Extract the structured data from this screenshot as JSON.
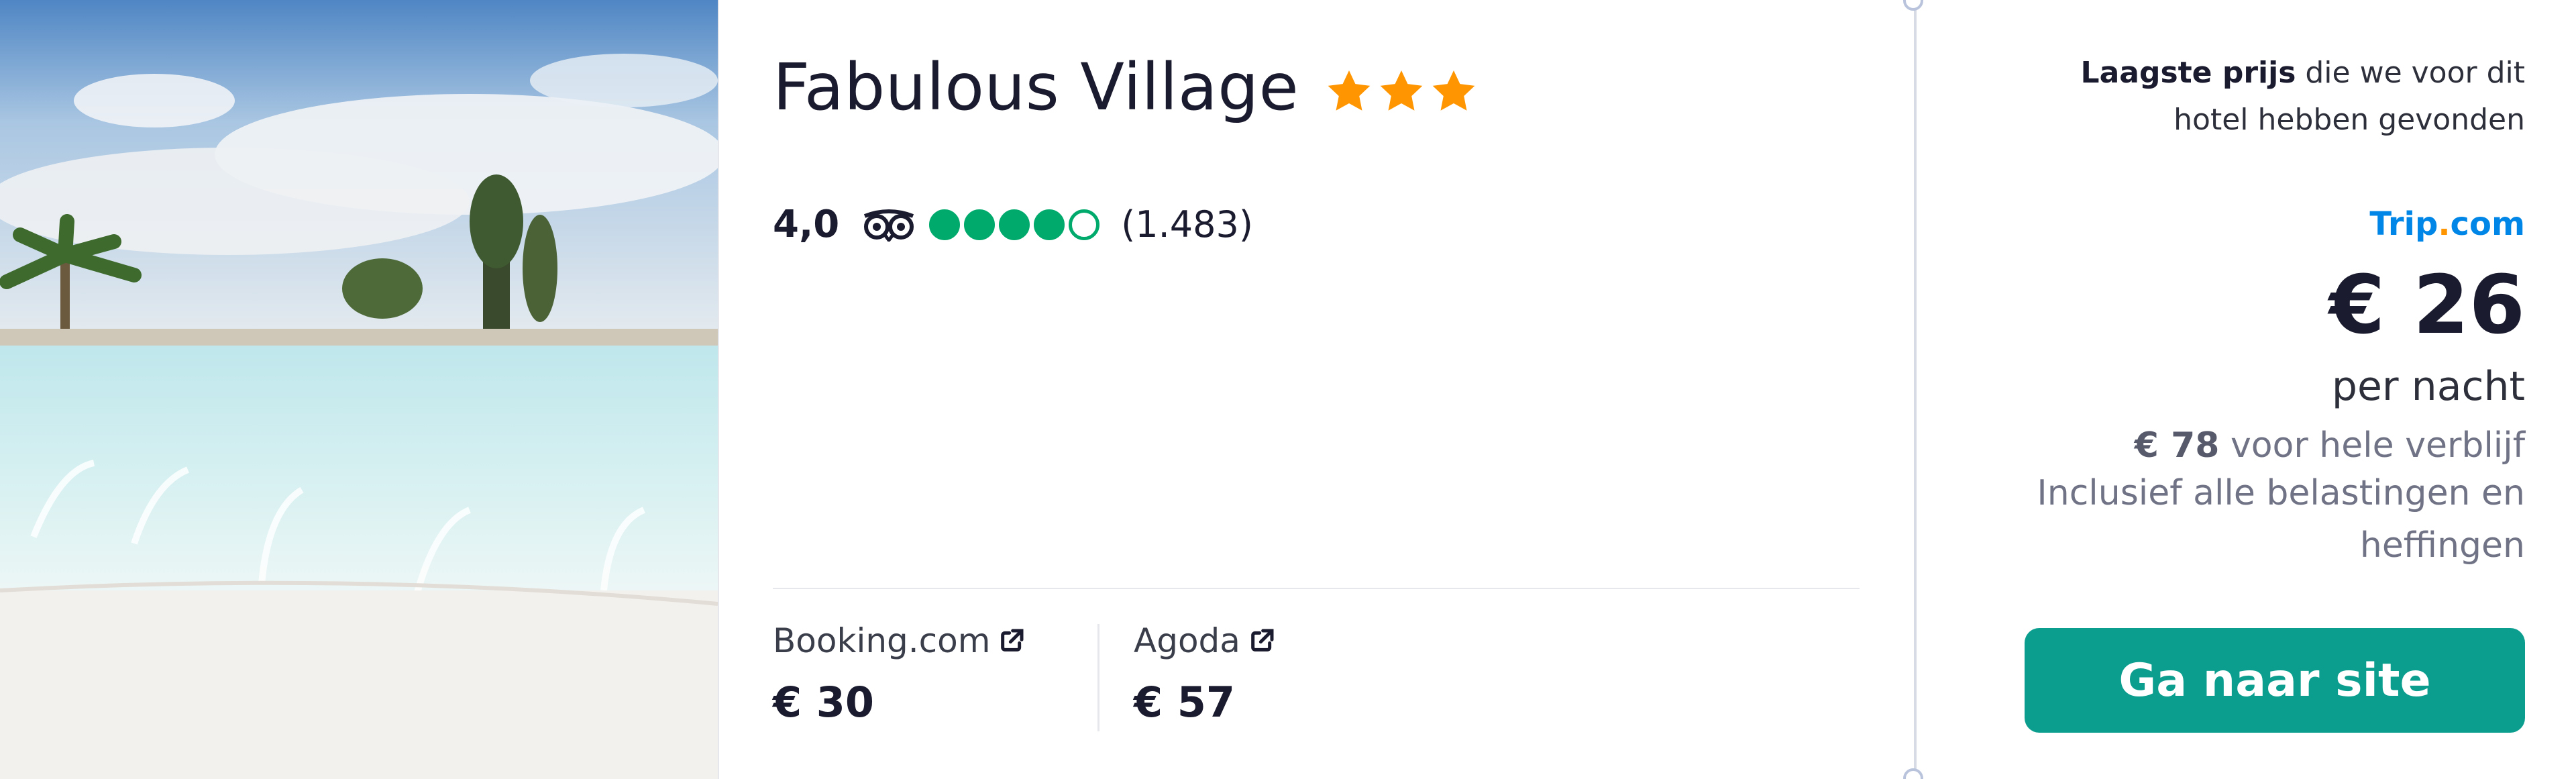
{
  "hotel": {
    "name": "Fabulous Village",
    "star_rating": 3,
    "rating": "4,0",
    "bubble_rating": 4,
    "bubble_max": 5,
    "review_count": "(1.483)"
  },
  "offers": [
    {
      "provider": "Booking.com",
      "price": "€ 30"
    },
    {
      "provider": "Agoda",
      "price": "€ 57"
    }
  ],
  "panel": {
    "lowest_bold": "Laagste prijs",
    "lowest_rest": " die we voor dit",
    "lowest_line2": "hotel hebben gevonden",
    "site_part1": "Trip",
    "site_dot": ".",
    "site_part2": "com",
    "price": "€ 26",
    "per_night": "per nacht",
    "total_price": "€ 78",
    "total_label": " voor hele verblijf",
    "taxes_line1": "Inclusief alle belastingen en",
    "taxes_line2": "heffingen",
    "cta_label": "Ga naar site"
  },
  "colors": {
    "star": "#ff9500",
    "bubble": "#00aa6c",
    "cta": "#0b9e8f",
    "site_link": "#0086e6"
  },
  "icons": [
    "star-icon",
    "tripadvisor-owl-icon",
    "external-link-icon"
  ]
}
